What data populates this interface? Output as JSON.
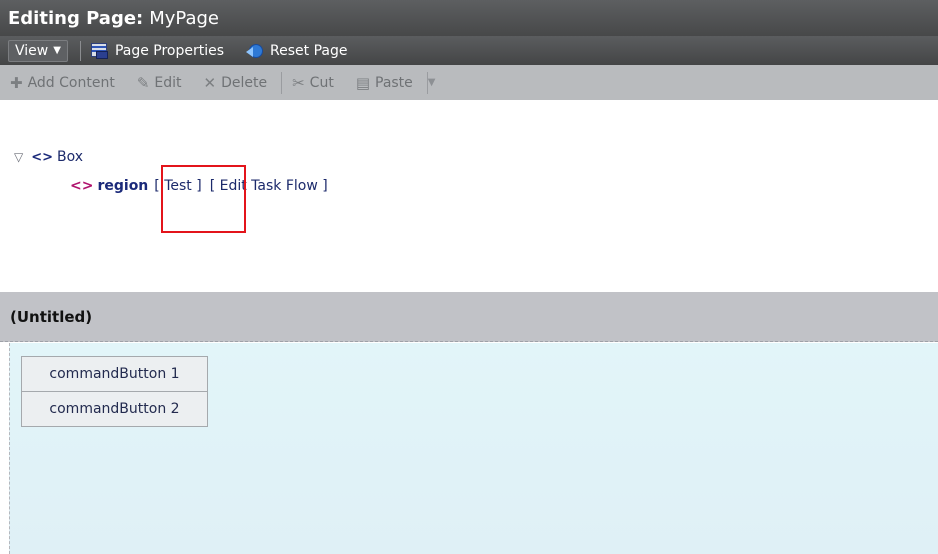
{
  "header": {
    "title_label": "Editing Page:",
    "title_value": "MyPage"
  },
  "menu": {
    "view_label": "View",
    "page_properties_label": "Page Properties",
    "reset_page_label": "Reset Page"
  },
  "toolbar": {
    "add_content_label": "Add Content",
    "edit_label": "Edit",
    "delete_label": "Delete",
    "cut_label": "Cut",
    "paste_label": "Paste"
  },
  "tree": {
    "box_label": "Box",
    "region_label": "region",
    "test_link": "[ Test ]",
    "edit_task_flow_link": "[ Edit Task Flow ]"
  },
  "panel": {
    "title": "(Untitled)",
    "buttons": [
      "commandButton 1",
      "commandButton 2"
    ]
  },
  "colors": {
    "title_bar": "#4f5152",
    "toolbar_bg": "#b9bbbe",
    "highlight_border": "#e3141b",
    "panel_body_bg": "#e0f3f8"
  }
}
